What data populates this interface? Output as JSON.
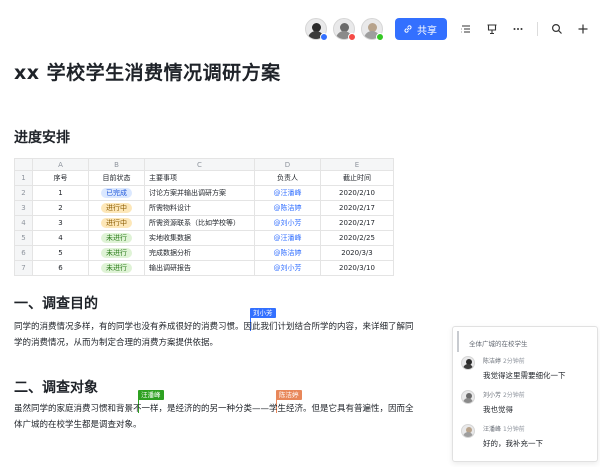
{
  "topbar": {
    "share_label": "共享",
    "collaborators": [
      {
        "name": "collaborator-1",
        "status_color": "#3370ff"
      },
      {
        "name": "collaborator-2",
        "status_color": "#f54a45"
      },
      {
        "name": "collaborator-3",
        "status_color": "#34c724"
      }
    ],
    "accent": "#3370ff"
  },
  "doc": {
    "title": "xx 学校学生消费情况调研方案",
    "progress_heading": "进度安排",
    "sheet": {
      "col_letters": [
        "A",
        "B",
        "C",
        "D",
        "E"
      ],
      "row_numbers": [
        "1",
        "2",
        "3",
        "4",
        "5",
        "6",
        "7"
      ],
      "headers": [
        "序号",
        "目前状态",
        "主要事项",
        "负责人",
        "截止时间"
      ],
      "rows": [
        {
          "no": "1",
          "status": "已完成",
          "status_type": "done",
          "task": "讨论方案并输出调研方案",
          "owner": "@汪潘峰",
          "due": "2020/2/10"
        },
        {
          "no": "2",
          "status": "进行中",
          "status_type": "doing",
          "task": "所需物料设计",
          "owner": "@陈洁婷",
          "due": "2020/2/17"
        },
        {
          "no": "3",
          "status": "进行中",
          "status_type": "doing",
          "task": "所需资源联系（比如学校等）",
          "owner": "@刘小芳",
          "due": "2020/2/17"
        },
        {
          "no": "4",
          "status": "未进行",
          "status_type": "todo",
          "task": "实地收集数据",
          "owner": "@汪潘峰",
          "due": "2020/2/25"
        },
        {
          "no": "5",
          "status": "未进行",
          "status_type": "todo",
          "task": "完成数据分析",
          "owner": "@陈洁婷",
          "due": "2020/3/3"
        },
        {
          "no": "6",
          "status": "未进行",
          "status_type": "todo",
          "task": "输出调研报告",
          "owner": "@刘小芳",
          "due": "2020/3/10"
        }
      ]
    },
    "section1": {
      "heading": "一、调查目的",
      "text": "同学的消费情况多样，有的同学也没有养成很好的消费习惯。因此我们计划结合所学的内容，来详细了解同学的消费情况，从而为制定合理的消费方案提供依据。"
    },
    "section2": {
      "heading": "二、调查对象",
      "text": "虽然同学的家庭消费习惯和背景不一样，是经济的的另一种分类——学生经济。但是它具有普遍性，因而全体广城的在校学生都是调查对象。"
    },
    "cursors": [
      {
        "label": "刘小芳",
        "color": "#3370ff"
      },
      {
        "label": "汪潘峰",
        "color": "#2ea121"
      },
      {
        "label": "陈洁婷",
        "color": "#e8875a"
      }
    ]
  },
  "comments": {
    "quote": "全体广城的在校学生",
    "items": [
      {
        "name": "陈洁婷",
        "time": "2分钟前",
        "text": "我觉得这里需要细化一下"
      },
      {
        "name": "刘小芳",
        "time": "2分钟前",
        "text": "我也觉得"
      },
      {
        "name": "汪潘峰",
        "time": "1分钟前",
        "text": "好的，我补充一下"
      }
    ]
  }
}
